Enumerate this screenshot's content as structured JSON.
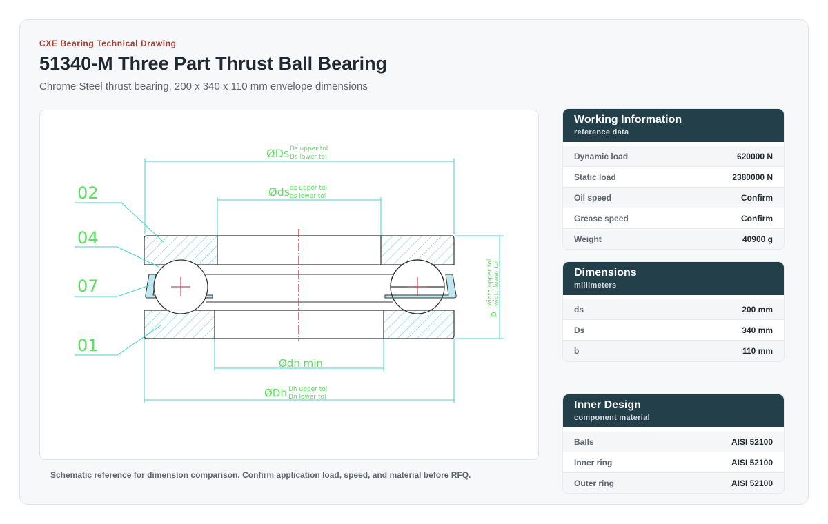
{
  "header": {
    "eyebrow": "CXE Bearing Technical Drawing",
    "title": "51340-M Three Part Thrust Ball Bearing",
    "subtitle": "Chrome Steel thrust bearing, 200 x 340 x 110 mm envelope dimensions"
  },
  "drawing": {
    "callouts": [
      "02",
      "04",
      "07",
      "01"
    ],
    "Ds_label": "ØDs",
    "Ds_upper": "Ds upper tol",
    "Ds_lower": "Ds lower tol",
    "ds_label": "Øds",
    "ds_upper": "ds upper tol",
    "ds_lower": "ds lower tol",
    "dh_label": "Ødh min",
    "Dh_label": "ØDh",
    "Dh_upper": "Dh upper tol",
    "Dh_lower": "Dn lower tol",
    "b_label": "b",
    "b_upper": "width upper tol",
    "b_lower": "width lower tol",
    "colors": {
      "dimension": "#38d7d2",
      "text": "#57e25c",
      "hatch": "#4fc9e6",
      "centerline": "#b3282c",
      "outline": "#333333"
    }
  },
  "caption": "Schematic reference for dimension comparison. Confirm application load, speed, and material before RFQ.",
  "working": {
    "title": "Working Information",
    "sub": "reference data",
    "rows": [
      {
        "k": "Dynamic load",
        "v": "620000 N"
      },
      {
        "k": "Static load",
        "v": "2380000 N"
      },
      {
        "k": "Oil speed",
        "v": "Confirm"
      },
      {
        "k": "Grease speed",
        "v": "Confirm"
      },
      {
        "k": "Weight",
        "v": "40900 g"
      }
    ]
  },
  "dimensions": {
    "title": "Dimensions",
    "sub": "millimeters",
    "rows": [
      {
        "k": "ds",
        "v": "200 mm"
      },
      {
        "k": "Ds",
        "v": "340 mm"
      },
      {
        "k": "b",
        "v": "110 mm"
      }
    ]
  },
  "inner": {
    "title": "Inner Design",
    "sub": "component material",
    "rows": [
      {
        "k": "Balls",
        "v": "AISI 52100"
      },
      {
        "k": "Inner ring",
        "v": "AISI 52100"
      },
      {
        "k": "Outer ring",
        "v": "AISI 52100"
      }
    ]
  }
}
